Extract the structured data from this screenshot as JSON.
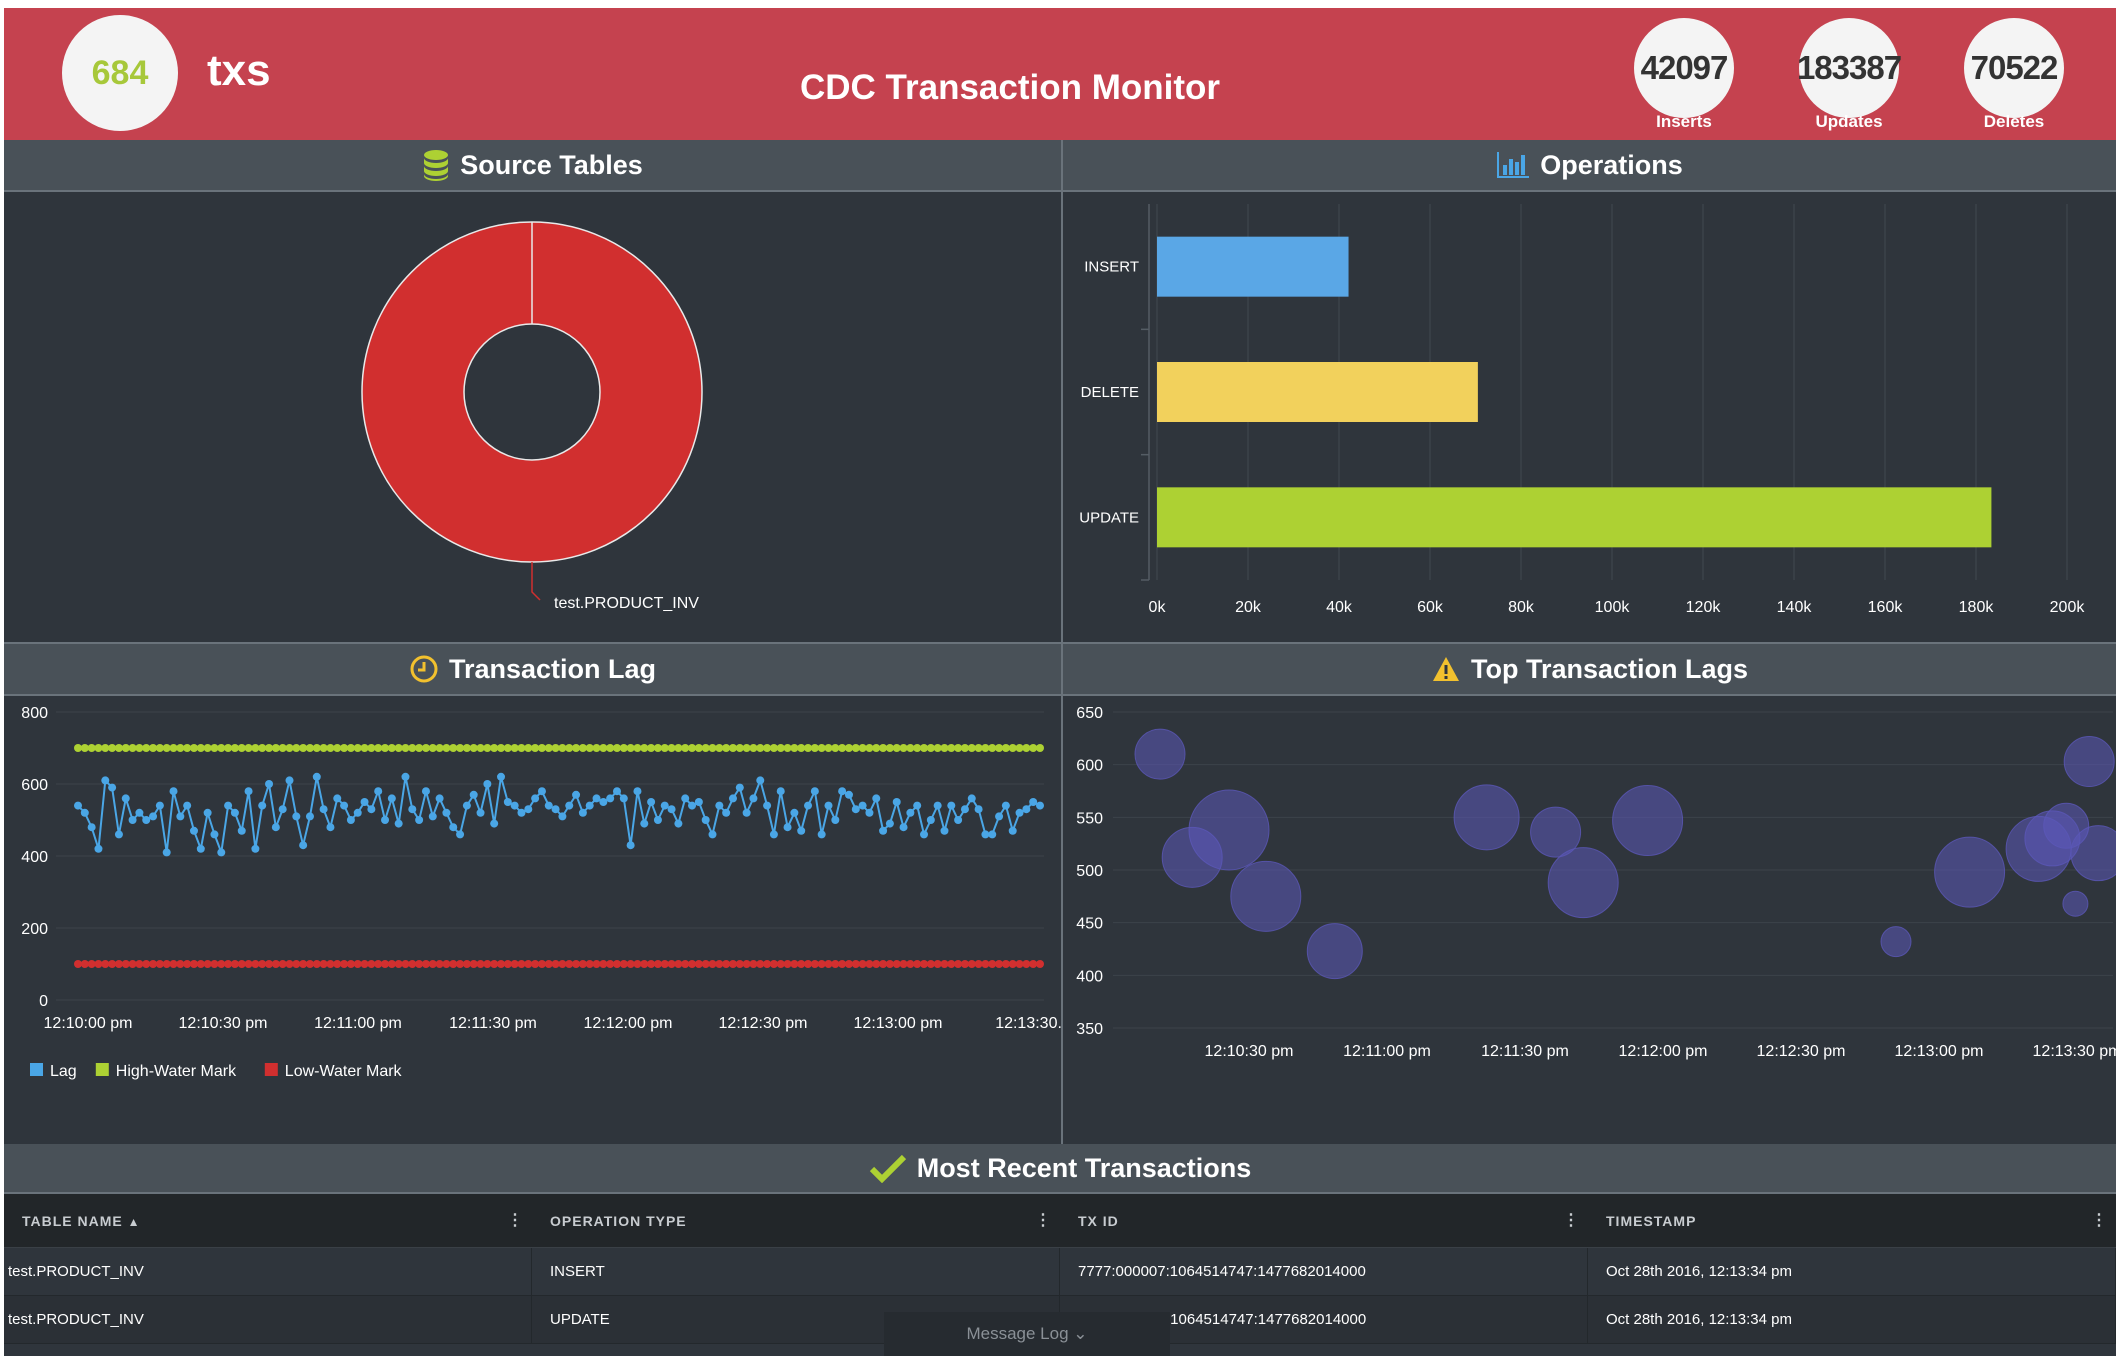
{
  "header": {
    "tx_count": "684",
    "tx_unit": "txs",
    "title": "CDC Transaction Monitor",
    "stats": [
      {
        "value": "42097",
        "label": "Inserts"
      },
      {
        "value": "183387",
        "label": "Updates"
      },
      {
        "value": "70522",
        "label": "Deletes"
      }
    ]
  },
  "source_tables": {
    "title": "Source Tables",
    "icon": "database-icon",
    "chart_data": {
      "type": "pie",
      "labels": [
        "test.PRODUCT_INV"
      ],
      "values": [
        100
      ],
      "colors": [
        "#d12f2f"
      ]
    }
  },
  "operations": {
    "title": "Operations",
    "icon": "bar-chart-icon",
    "chart_data": {
      "type": "bar",
      "orientation": "horizontal",
      "categories": [
        "INSERT",
        "DELETE",
        "UPDATE"
      ],
      "values": [
        42097,
        70522,
        183387
      ],
      "colors": [
        "#5aa7e6",
        "#f2d15c",
        "#add133"
      ],
      "xlim": [
        0,
        200000
      ],
      "xticks": [
        "0k",
        "20k",
        "40k",
        "60k",
        "80k",
        "100k",
        "120k",
        "140k",
        "160k",
        "180k",
        "200k"
      ]
    }
  },
  "transaction_lag": {
    "title": "Transaction Lag",
    "icon": "clock-icon",
    "chart_data": {
      "type": "line",
      "ylim": [
        0,
        800
      ],
      "yticks": [
        "0",
        "200",
        "400",
        "600",
        "800"
      ],
      "xticks": [
        "12:10:00 pm",
        "12:10:30 pm",
        "12:11:00 pm",
        "12:11:30 pm",
        "12:12:00 pm",
        "12:12:30 pm",
        "12:13:00 pm",
        "12:13:30..."
      ],
      "series": [
        {
          "name": "Lag",
          "color": "#4aa6e6",
          "values": [
            540,
            520,
            480,
            420,
            610,
            590,
            460,
            560,
            500,
            520,
            500,
            510,
            540,
            410,
            580,
            510,
            540,
            470,
            420,
            520,
            460,
            410,
            540,
            520,
            470,
            580,
            420,
            540,
            600,
            480,
            530,
            610,
            510,
            430,
            510,
            620,
            530,
            480,
            560,
            540,
            500,
            520,
            550,
            530,
            580,
            500,
            560,
            490,
            620,
            530,
            500,
            580,
            510,
            560,
            520,
            480,
            460,
            540,
            570,
            520,
            600,
            490,
            620,
            550,
            540,
            520,
            530,
            560,
            580,
            540,
            530,
            510,
            540,
            570,
            520,
            540,
            560,
            550,
            560,
            580,
            560,
            430,
            580,
            490,
            550,
            500,
            540,
            530,
            490,
            560,
            540,
            550,
            500,
            460,
            540,
            520,
            560,
            590,
            520,
            560,
            610,
            540,
            460,
            580,
            480,
            520,
            470,
            540,
            580,
            460,
            540,
            500,
            580,
            570,
            530,
            540,
            520,
            560,
            470,
            490,
            550,
            480,
            520,
            540,
            460,
            500,
            540,
            470,
            540,
            500,
            530,
            560,
            530,
            460,
            460,
            510,
            540,
            470,
            520,
            530,
            550,
            540
          ]
        },
        {
          "name": "High-Water Mark",
          "color": "#add133",
          "constant": 700
        },
        {
          "name": "Low-Water Mark",
          "color": "#d12f2f",
          "constant": 100
        }
      ]
    }
  },
  "top_lags": {
    "title": "Top Transaction Lags",
    "icon": "warning-icon",
    "chart_data": {
      "type": "scatter",
      "ylim": [
        350,
        650
      ],
      "yticks": [
        "350",
        "400",
        "450",
        "500",
        "550",
        "600",
        "650"
      ],
      "xticks": [
        "12:10:30 pm",
        "12:11:00 pm",
        "12:11:30 pm",
        "12:12:00 pm",
        "12:12:30 pm",
        "12:13:00 pm",
        "12:13:30 pm"
      ],
      "color": "#5b58b8",
      "points": [
        {
          "t": 5,
          "y": 610,
          "r": 20
        },
        {
          "t": 12,
          "y": 512,
          "r": 24
        },
        {
          "t": 20,
          "y": 538,
          "r": 32
        },
        {
          "t": 28,
          "y": 475,
          "r": 28
        },
        {
          "t": 43,
          "y": 423,
          "r": 22
        },
        {
          "t": 76,
          "y": 550,
          "r": 26
        },
        {
          "t": 91,
          "y": 536,
          "r": 20
        },
        {
          "t": 97,
          "y": 488,
          "r": 28
        },
        {
          "t": 111,
          "y": 547,
          "r": 28
        },
        {
          "t": 165,
          "y": 432,
          "r": 12
        },
        {
          "t": 181,
          "y": 498,
          "r": 28
        },
        {
          "t": 196,
          "y": 520,
          "r": 26
        },
        {
          "t": 199,
          "y": 530,
          "r": 22
        },
        {
          "t": 202,
          "y": 542,
          "r": 18
        },
        {
          "t": 204,
          "y": 468,
          "r": 10
        },
        {
          "t": 207,
          "y": 603,
          "r": 20
        },
        {
          "t": 209,
          "y": 516,
          "r": 22
        },
        {
          "t": 222,
          "y": 535,
          "r": 24
        },
        {
          "t": 235,
          "y": 562,
          "r": 20
        }
      ]
    }
  },
  "recent": {
    "title": "Most Recent Transactions",
    "icon": "checkmark-icon",
    "columns": [
      "TABLE NAME",
      "OPERATION TYPE",
      "TX ID",
      "TIMESTAMP"
    ],
    "rows": [
      [
        "test.PRODUCT_INV",
        "INSERT",
        "7777:000007:1064514747:1477682014000",
        "Oct 28th 2016, 12:13:34 pm"
      ],
      [
        "test.PRODUCT_INV",
        "UPDATE",
        ":1064514747:1477682014000",
        "Oct 28th 2016, 12:13:34 pm"
      ]
    ],
    "message_log": "Message Log"
  }
}
